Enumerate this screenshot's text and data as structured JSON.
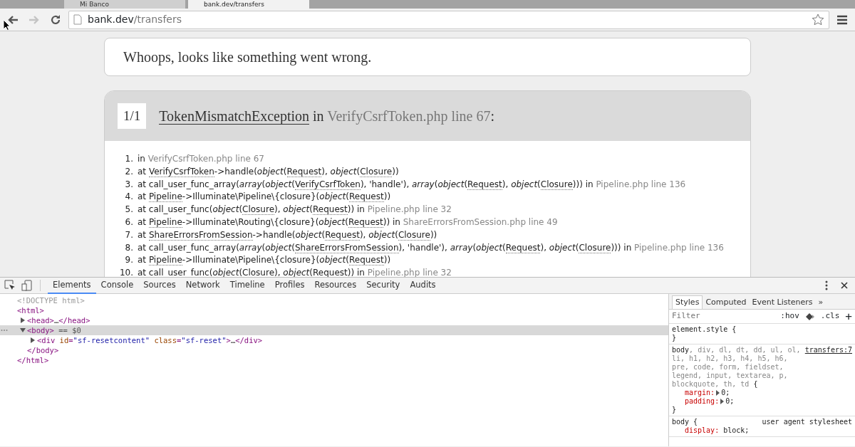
{
  "browser": {
    "tabs": [
      {
        "title": "Mi Banco",
        "selected": false
      },
      {
        "title": "bank.dev/transfers",
        "selected": true
      }
    ],
    "forward_disabled": true,
    "url": {
      "host": "bank.dev",
      "path": "/transfers"
    }
  },
  "page": {
    "message": "Whoops, looks like something went wrong.",
    "exception": {
      "count": "1/1",
      "class": "TokenMismatchException",
      "joiner": " in ",
      "location": "VerifyCsrfToken.php line 67",
      "end": ":"
    },
    "trace": [
      {
        "number": "1.",
        "parts": [
          {
            "kind": "text",
            "text": "in "
          },
          {
            "kind": "file",
            "text": "VerifyCsrfToken.php line 67"
          }
        ]
      },
      {
        "number": "2.",
        "parts": [
          {
            "kind": "text",
            "text": "at "
          },
          {
            "kind": "abbr",
            "text": "VerifyCsrfToken"
          },
          {
            "kind": "text",
            "text": "->handle("
          },
          {
            "kind": "em",
            "text": "object"
          },
          {
            "kind": "text",
            "text": "("
          },
          {
            "kind": "abbr",
            "text": "Request"
          },
          {
            "kind": "text",
            "text": "), "
          },
          {
            "kind": "em",
            "text": "object"
          },
          {
            "kind": "text",
            "text": "("
          },
          {
            "kind": "abbr",
            "text": "Closure"
          },
          {
            "kind": "text",
            "text": "))"
          }
        ]
      },
      {
        "number": "3.",
        "parts": [
          {
            "kind": "text",
            "text": "at call_user_func_array("
          },
          {
            "kind": "em",
            "text": "array"
          },
          {
            "kind": "text",
            "text": "("
          },
          {
            "kind": "em",
            "text": "object"
          },
          {
            "kind": "text",
            "text": "("
          },
          {
            "kind": "abbr",
            "text": "VerifyCsrfToken"
          },
          {
            "kind": "text",
            "text": "), 'handle'), "
          },
          {
            "kind": "em",
            "text": "array"
          },
          {
            "kind": "text",
            "text": "("
          },
          {
            "kind": "em",
            "text": "object"
          },
          {
            "kind": "text",
            "text": "("
          },
          {
            "kind": "abbr",
            "text": "Request"
          },
          {
            "kind": "text",
            "text": "), "
          },
          {
            "kind": "em",
            "text": "object"
          },
          {
            "kind": "text",
            "text": "("
          },
          {
            "kind": "abbr",
            "text": "Closure"
          },
          {
            "kind": "text",
            "text": "))) in "
          },
          {
            "kind": "file",
            "text": "Pipeline.php line 136"
          }
        ]
      },
      {
        "number": "4.",
        "parts": [
          {
            "kind": "text",
            "text": "at "
          },
          {
            "kind": "abbr",
            "text": "Pipeline"
          },
          {
            "kind": "text",
            "text": "->Illuminate\\Pipeline\\{closure}("
          },
          {
            "kind": "em",
            "text": "object"
          },
          {
            "kind": "text",
            "text": "("
          },
          {
            "kind": "abbr",
            "text": "Request"
          },
          {
            "kind": "text",
            "text": "))"
          }
        ]
      },
      {
        "number": "5.",
        "parts": [
          {
            "kind": "text",
            "text": "at call_user_func("
          },
          {
            "kind": "em",
            "text": "object"
          },
          {
            "kind": "text",
            "text": "("
          },
          {
            "kind": "abbr",
            "text": "Closure"
          },
          {
            "kind": "text",
            "text": "), "
          },
          {
            "kind": "em",
            "text": "object"
          },
          {
            "kind": "text",
            "text": "("
          },
          {
            "kind": "abbr",
            "text": "Request"
          },
          {
            "kind": "text",
            "text": ")) in "
          },
          {
            "kind": "file",
            "text": "Pipeline.php line 32"
          }
        ]
      },
      {
        "number": "6.",
        "parts": [
          {
            "kind": "text",
            "text": "at "
          },
          {
            "kind": "abbr",
            "text": "Pipeline"
          },
          {
            "kind": "text",
            "text": "->Illuminate\\Routing\\{closure}("
          },
          {
            "kind": "em",
            "text": "object"
          },
          {
            "kind": "text",
            "text": "("
          },
          {
            "kind": "abbr",
            "text": "Request"
          },
          {
            "kind": "text",
            "text": ")) in "
          },
          {
            "kind": "file",
            "text": "ShareErrorsFromSession.php line 49"
          }
        ]
      },
      {
        "number": "7.",
        "parts": [
          {
            "kind": "text",
            "text": "at "
          },
          {
            "kind": "abbr",
            "text": "ShareErrorsFromSession"
          },
          {
            "kind": "text",
            "text": "->handle("
          },
          {
            "kind": "em",
            "text": "object"
          },
          {
            "kind": "text",
            "text": "("
          },
          {
            "kind": "abbr",
            "text": "Request"
          },
          {
            "kind": "text",
            "text": "), "
          },
          {
            "kind": "em",
            "text": "object"
          },
          {
            "kind": "text",
            "text": "("
          },
          {
            "kind": "abbr",
            "text": "Closure"
          },
          {
            "kind": "text",
            "text": "))"
          }
        ]
      },
      {
        "number": "8.",
        "parts": [
          {
            "kind": "text",
            "text": "at call_user_func_array("
          },
          {
            "kind": "em",
            "text": "array"
          },
          {
            "kind": "text",
            "text": "("
          },
          {
            "kind": "em",
            "text": "object"
          },
          {
            "kind": "text",
            "text": "("
          },
          {
            "kind": "abbr",
            "text": "ShareErrorsFromSession"
          },
          {
            "kind": "text",
            "text": "), 'handle'), "
          },
          {
            "kind": "em",
            "text": "array"
          },
          {
            "kind": "text",
            "text": "("
          },
          {
            "kind": "em",
            "text": "object"
          },
          {
            "kind": "text",
            "text": "("
          },
          {
            "kind": "abbr",
            "text": "Request"
          },
          {
            "kind": "text",
            "text": "), "
          },
          {
            "kind": "em",
            "text": "object"
          },
          {
            "kind": "text",
            "text": "("
          },
          {
            "kind": "abbr",
            "text": "Closure"
          },
          {
            "kind": "text",
            "text": "))) in "
          },
          {
            "kind": "file",
            "text": "Pipeline.php line 136"
          }
        ]
      },
      {
        "number": "9.",
        "parts": [
          {
            "kind": "text",
            "text": "at "
          },
          {
            "kind": "abbr",
            "text": "Pipeline"
          },
          {
            "kind": "text",
            "text": "->Illuminate\\Pipeline\\{closure}("
          },
          {
            "kind": "em",
            "text": "object"
          },
          {
            "kind": "text",
            "text": "("
          },
          {
            "kind": "abbr",
            "text": "Request"
          },
          {
            "kind": "text",
            "text": "))"
          }
        ]
      },
      {
        "number": "10.",
        "parts": [
          {
            "kind": "text",
            "text": "at call_user_func("
          },
          {
            "kind": "em",
            "text": "object"
          },
          {
            "kind": "text",
            "text": "("
          },
          {
            "kind": "abbr",
            "text": "Closure"
          },
          {
            "kind": "text",
            "text": "), "
          },
          {
            "kind": "em",
            "text": "object"
          },
          {
            "kind": "text",
            "text": "("
          },
          {
            "kind": "abbr",
            "text": "Request"
          },
          {
            "kind": "text",
            "text": ")) in "
          },
          {
            "kind": "file",
            "text": "Pipeline.php line 32"
          }
        ]
      }
    ]
  },
  "devtools": {
    "tabs": [
      {
        "label": "Elements",
        "selected": true
      },
      {
        "label": "Console",
        "selected": false
      },
      {
        "label": "Sources",
        "selected": false
      },
      {
        "label": "Network",
        "selected": false
      },
      {
        "label": "Timeline",
        "selected": false
      },
      {
        "label": "Profiles",
        "selected": false
      },
      {
        "label": "Resources",
        "selected": false
      },
      {
        "label": "Security",
        "selected": false
      },
      {
        "label": "Audits",
        "selected": false
      }
    ],
    "dom": [
      {
        "open": [
          {
            "kind": "doctype",
            "text": "<!DOCTYPE html>"
          }
        ],
        "selected": false
      },
      {
        "open": [
          {
            "kind": "tag",
            "text": "<html>"
          }
        ],
        "selected": false,
        "close": [
          {
            "kind": "tag",
            "text": "</html>"
          }
        ],
        "children": [
          {
            "open": [
              {
                "kind": "tag",
                "text": "<head>"
              },
              {
                "kind": "plain",
                "text": "…"
              },
              {
                "kind": "tag",
                "text": "</head>"
              }
            ],
            "expanded": false,
            "selected": false
          },
          {
            "open": [
              {
                "kind": "tag",
                "text": "<body>"
              },
              {
                "kind": "note",
                "text": " == $0"
              }
            ],
            "expanded": true,
            "selected": true,
            "close": [
              {
                "kind": "tag",
                "text": "</body>"
              }
            ],
            "children": [
              {
                "open": [
                  {
                    "kind": "tag",
                    "text": "<div"
                  },
                  {
                    "kind": "attr",
                    "text": " id"
                  },
                  {
                    "kind": "tag",
                    "text": "="
                  },
                  {
                    "kind": "value",
                    "text": "\"sf-resetcontent\""
                  },
                  {
                    "kind": "attr",
                    "text": " class"
                  },
                  {
                    "kind": "tag",
                    "text": "="
                  },
                  {
                    "kind": "value",
                    "text": "\"sf-reset\""
                  },
                  {
                    "kind": "tag",
                    "text": ">"
                  },
                  {
                    "kind": "plain",
                    "text": "…"
                  },
                  {
                    "kind": "tag",
                    "text": "</div>"
                  }
                ],
                "expanded": false,
                "selected": false
              }
            ]
          }
        ]
      }
    ],
    "styles": {
      "tabs": [
        {
          "label": "Styles",
          "selected": true
        },
        {
          "label": "Computed",
          "selected": false
        },
        {
          "label": "Event Listeners",
          "selected": false
        }
      ],
      "more": "»",
      "filter": {
        "placeholder": "Filter"
      },
      "hov": ":hov",
      "cls": ".cls",
      "add": "+",
      "rules": [
        {
          "selector": [
            {
              "text": "element.style",
              "matched": true
            }
          ],
          "open": " {",
          "close": "}"
        },
        {
          "selector": [
            {
              "text": "body",
              "matched": true
            },
            {
              "text": ", div, dl, dt, dd, ul, ol, li, h1, h2, h3, h4, h5, h6, pre, code, form, fieldset, legend, input, textarea, p, blockquote, th, td",
              "matched": false
            }
          ],
          "source": "transfers:7",
          "open": " {",
          "close": "}",
          "declarations": [
            {
              "property": "margin:",
              "value": "0;",
              "expandable": true
            },
            {
              "property": "padding:",
              "value": "0;",
              "expandable": true
            }
          ]
        },
        {
          "selector": [
            {
              "text": "body",
              "matched": true
            }
          ],
          "source": "user agent stylesheet",
          "open": " {",
          "declarations": [
            {
              "property": "display:",
              "value": "block;",
              "expandable": false
            }
          ]
        }
      ]
    }
  }
}
